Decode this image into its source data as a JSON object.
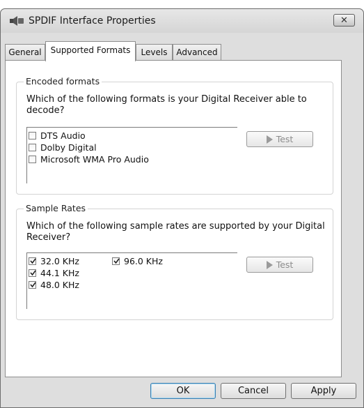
{
  "window": {
    "title": "SPDIF Interface Properties",
    "close_label": "✕"
  },
  "tabs": [
    {
      "label": "General"
    },
    {
      "label": "Supported Formats"
    },
    {
      "label": "Levels"
    },
    {
      "label": "Advanced"
    }
  ],
  "encoded": {
    "title": "Encoded formats",
    "question": "Which of the following formats is your Digital Receiver able to decode?",
    "items": [
      {
        "label": "DTS Audio",
        "checked": false
      },
      {
        "label": "Dolby Digital",
        "checked": false
      },
      {
        "label": "Microsoft WMA Pro Audio",
        "checked": false
      }
    ],
    "test_label": "Test"
  },
  "rates": {
    "title": "Sample Rates",
    "question": "Which of the following sample rates are supported by your Digital Receiver?",
    "items": [
      {
        "label": "32.0 KHz",
        "checked": true
      },
      {
        "label": "44.1 KHz",
        "checked": true
      },
      {
        "label": "48.0 KHz",
        "checked": true
      },
      {
        "label": "96.0 KHz",
        "checked": true
      }
    ],
    "test_label": "Test"
  },
  "footer": {
    "ok": "OK",
    "cancel": "Cancel",
    "apply": "Apply"
  }
}
